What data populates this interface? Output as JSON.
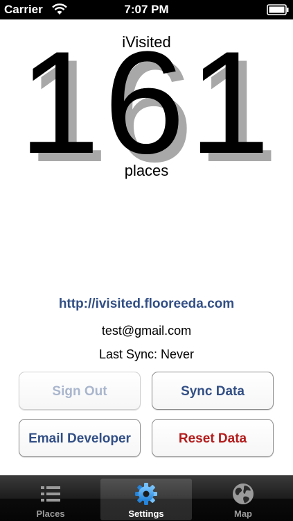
{
  "status_bar": {
    "carrier": "Carrier",
    "time": "7:07 PM"
  },
  "main": {
    "app_title": "iVisited",
    "count": "161",
    "count_unit": "places",
    "site_link": "http://ivisited.flooreeda.com",
    "account_email": "test@gmail.com",
    "last_sync_label": "Last Sync:",
    "last_sync_value": "Never"
  },
  "buttons": {
    "sign_out": "Sign Out",
    "sync_data": "Sync Data",
    "email_developer": "Email Developer",
    "reset_data": "Reset Data"
  },
  "tab_bar": {
    "tabs": [
      {
        "label": "Places",
        "icon": "list-icon",
        "selected": false
      },
      {
        "label": "Settings",
        "icon": "gear-icon",
        "selected": true
      },
      {
        "label": "Map",
        "icon": "globe-icon",
        "selected": false
      }
    ]
  },
  "colors": {
    "link_blue": "#324f85",
    "danger_red": "#b31b1b",
    "disabled_text": "#a9b6cd",
    "selected_tab_icon": "#3a9be8"
  }
}
